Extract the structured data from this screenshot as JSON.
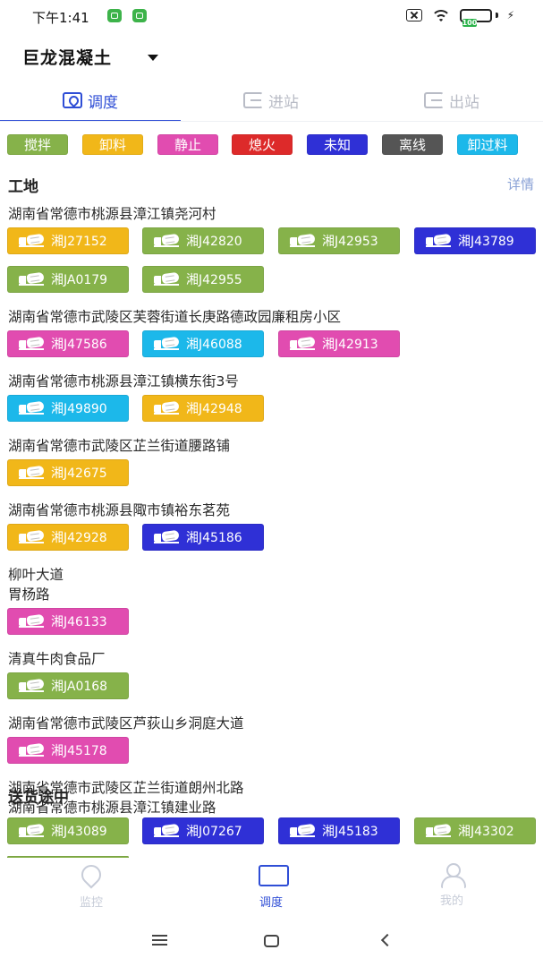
{
  "status_bar": {
    "time": "下午1:41",
    "battery": "100"
  },
  "header": {
    "company": "巨龙混凝土"
  },
  "tabs": [
    {
      "label": "调度",
      "icon": "map-pin-tab-icon",
      "active": true
    },
    {
      "label": "进站",
      "icon": "enter-station-icon",
      "active": false
    },
    {
      "label": "出站",
      "icon": "exit-station-icon",
      "active": false
    }
  ],
  "legend": [
    {
      "label": "搅拌",
      "color": "#86b24a"
    },
    {
      "label": "卸料",
      "color": "#f1b719"
    },
    {
      "label": "静止",
      "color": "#e14cb0"
    },
    {
      "label": "熄火",
      "color": "#dd2a2a"
    },
    {
      "label": "未知",
      "color": "#2f30d6"
    },
    {
      "label": "离线",
      "color": "#555555"
    },
    {
      "label": "卸过料",
      "color": "#1cb8ea"
    }
  ],
  "sites": {
    "title": "工地",
    "details": "详情",
    "groups": [
      {
        "address": "湖南省常德市桃源县漳江镇尧河村",
        "trucks": [
          {
            "plate": "湘J27152",
            "color": "#f1b719"
          },
          {
            "plate": "湘J42820",
            "color": "#86b24a"
          },
          {
            "plate": "湘J42953",
            "color": "#86b24a"
          },
          {
            "plate": "湘J43789",
            "color": "#2f30d6"
          },
          {
            "plate": "湘JA0179",
            "color": "#86b24a"
          },
          {
            "plate": "湘J42955",
            "color": "#86b24a"
          }
        ]
      },
      {
        "address": "湖南省常德市武陵区芙蓉街道长庚路德政园廉租房小区",
        "trucks": [
          {
            "plate": "湘J47586",
            "color": "#e14cb0"
          },
          {
            "plate": "湘J46088",
            "color": "#1cb8ea"
          },
          {
            "plate": "湘J42913",
            "color": "#e14cb0"
          }
        ]
      },
      {
        "address": "湖南省常德市桃源县漳江镇横东街3号",
        "trucks": [
          {
            "plate": "湘J49890",
            "color": "#1cb8ea"
          },
          {
            "plate": "湘J42948",
            "color": "#f1b719"
          }
        ]
      },
      {
        "address": "湖南省常德市武陵区芷兰街道腰路铺",
        "trucks": [
          {
            "plate": "湘J42675",
            "color": "#f1b719"
          }
        ]
      },
      {
        "address": "湖南省常德市桃源县陬市镇裕东茗苑",
        "trucks": [
          {
            "plate": "湘J42928",
            "color": "#f1b719"
          },
          {
            "plate": "湘J45186",
            "color": "#2f30d6"
          }
        ]
      },
      {
        "address": "柳叶大道",
        "address2": "胃杨路",
        "trucks": [
          {
            "plate": "湘J46133",
            "color": "#e14cb0"
          }
        ]
      },
      {
        "address": "清真牛肉食品厂",
        "trucks": [
          {
            "plate": "湘JA0168",
            "color": "#86b24a"
          }
        ]
      },
      {
        "address": "湖南省常德市武陵区芦荻山乡洞庭大道",
        "trucks": [
          {
            "plate": "湘J45178",
            "color": "#e14cb0"
          }
        ]
      },
      {
        "address": "湖南省常德市武陵区芷兰街道朗州北路",
        "address2": "湖南省常德市桃源县漳江镇建业路",
        "trucks": []
      }
    ]
  },
  "in_transit": {
    "title": "送货途中",
    "trucks": [
      {
        "plate": "湘J43089",
        "color": "#86b24a"
      },
      {
        "plate": "湘J07267",
        "color": "#2f30d6"
      },
      {
        "plate": "湘J45183",
        "color": "#2f30d6"
      },
      {
        "plate": "湘J43302",
        "color": "#86b24a"
      }
    ]
  },
  "bottom_nav": [
    {
      "label": "监控",
      "icon": "location-icon",
      "active": false
    },
    {
      "label": "调度",
      "icon": "truck-icon",
      "active": true
    },
    {
      "label": "我的",
      "icon": "person-icon",
      "active": false
    }
  ]
}
